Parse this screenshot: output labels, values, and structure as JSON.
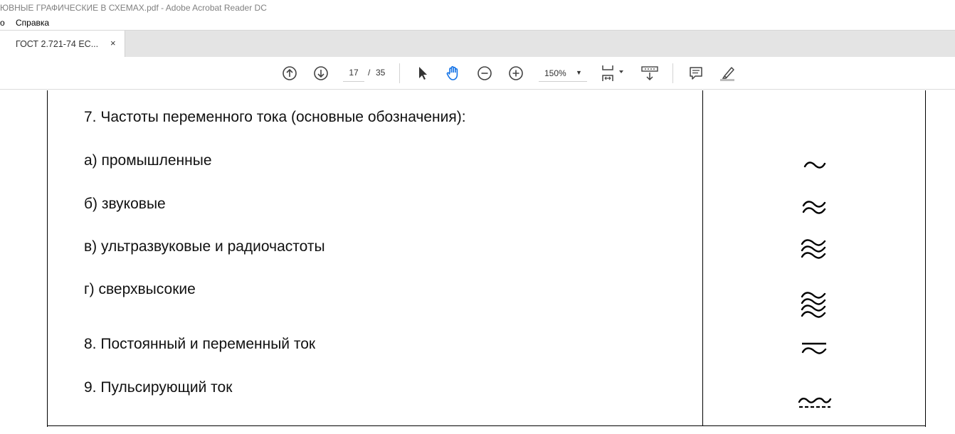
{
  "window": {
    "title": "ЮВНЫЕ ГРАФИЧЕСКИЕ В СХЕМАХ.pdf - Adobe Acrobat Reader DC"
  },
  "menu": {
    "items": [
      {
        "label": "о"
      },
      {
        "label": "Справка"
      }
    ]
  },
  "tabs": [
    {
      "label": "ГОСТ 2.721-74 ЕС...",
      "close": "×"
    }
  ],
  "toolbar": {
    "page_current": "17",
    "page_separator": "/",
    "page_total": "35",
    "zoom_value": "150%",
    "zoom_caret": "▼",
    "icons": [
      "prev-page-icon",
      "next-page-icon",
      "select-cursor-icon",
      "hand-tool-icon",
      "zoom-out-icon",
      "zoom-in-icon",
      "page-fit-icon",
      "scroll-mode-icon",
      "comment-icon",
      "highlight-pen-icon"
    ],
    "accent": "#1473e6"
  },
  "document": {
    "rows": [
      {
        "text": "7. Частоты переменного тока (основные обозначения):",
        "symbol": ""
      },
      {
        "text": "а) промышленные",
        "symbol": "single-wave"
      },
      {
        "text": "б) звуковые",
        "symbol": "double-wave"
      },
      {
        "text": "в) ультразвуковые и радиочастоты",
        "symbol": "triple-wave"
      },
      {
        "text": "г) сверхвысокие",
        "symbol": "quad-wave"
      },
      {
        "text": "8. Постоянный и переменный ток",
        "symbol": "dc-ac"
      },
      {
        "text": "9. Пульсирующий ток",
        "symbol": "pulsating"
      }
    ]
  }
}
